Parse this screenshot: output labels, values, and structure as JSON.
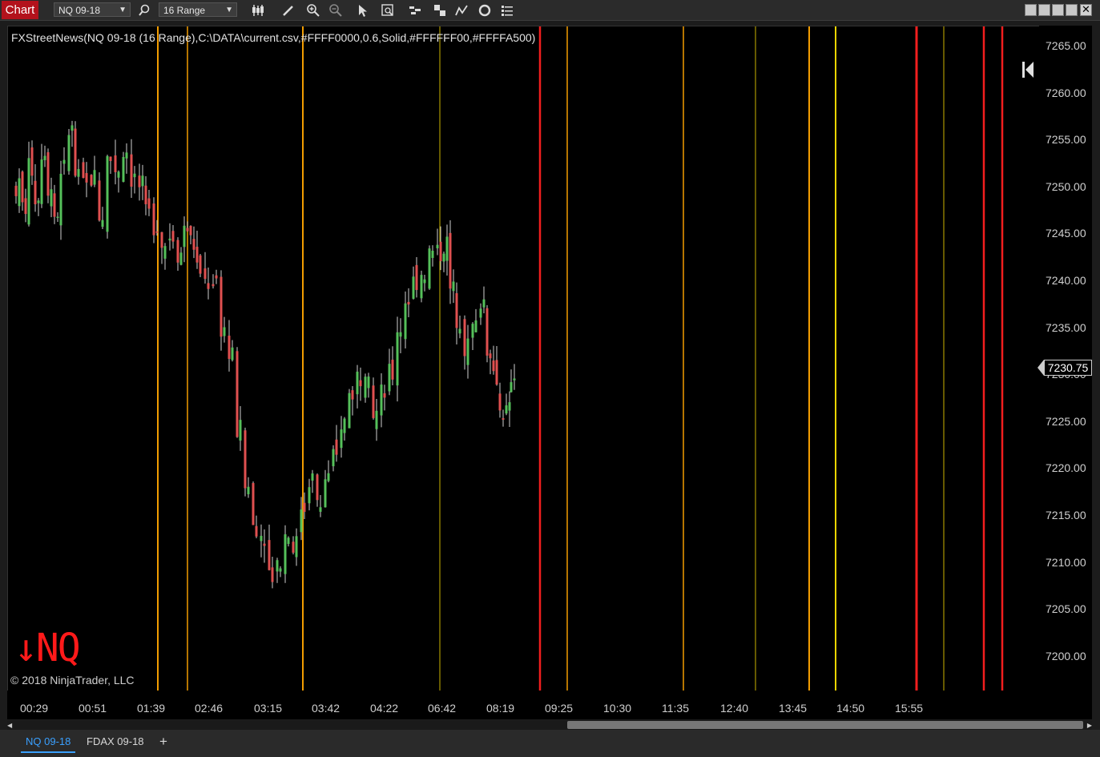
{
  "toolbar": {
    "chart_label": "Chart",
    "instrument": "NQ 09-18",
    "bar_type": "16 Range",
    "icons": [
      "search-icon",
      "bar-style-icon",
      "pencil-icon",
      "zoom-in-icon",
      "zoom-out-icon",
      "pointer-icon",
      "data-box-icon",
      "strategies-icon",
      "templates-icon",
      "indicators-icon",
      "reload-icon",
      "properties-icon"
    ]
  },
  "chart": {
    "indicator_label": "FXStreetNews(NQ 09-18 (16 Range),C:\\DATA\\current.csv,#FFFF0000,0.6,Solid,#FFFFFF00,#FFFFA500)",
    "copyright": "© 2018 NinjaTrader, LLC",
    "watermark": "↓NQ",
    "last_price": "7230.75",
    "price_ticks": [
      "7265.00",
      "7260.00",
      "7255.00",
      "7250.00",
      "7245.00",
      "7240.00",
      "7235.00",
      "7230.00",
      "7225.00",
      "7220.00",
      "7215.00",
      "7210.00",
      "7205.00",
      "7200.00"
    ],
    "time_ticks": [
      "00:29",
      "00:51",
      "01:39",
      "02:46",
      "03:15",
      "03:42",
      "04:22",
      "06:42",
      "08:19",
      "09:25",
      "10:30",
      "11:35",
      "12:40",
      "13:45",
      "14:50",
      "15:55"
    ],
    "colors": {
      "up": "#55c05a",
      "down": "#e05050",
      "red_line": "#ff2020",
      "orange_line": "#ffa500",
      "yellow_line": "#ffe000"
    }
  },
  "bottom_tabs": [
    "NQ 09-18",
    "FDAX 09-18",
    "+"
  ]
}
